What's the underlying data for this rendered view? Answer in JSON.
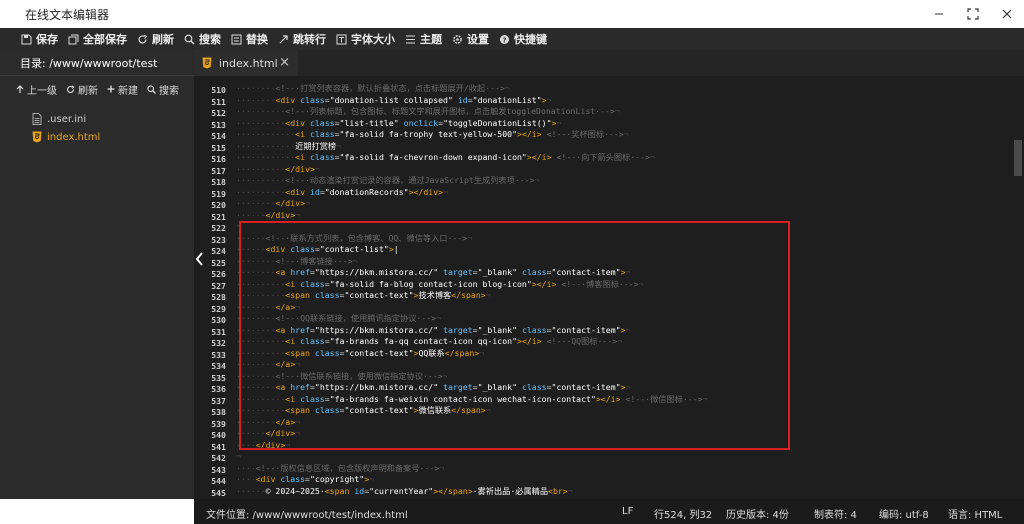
{
  "window": {
    "title": "在线文本编辑器"
  },
  "toolbar": {
    "items": [
      {
        "label": "保存",
        "icon": "save-icon"
      },
      {
        "label": "全部保存",
        "icon": "save-all-icon"
      },
      {
        "label": "刷新",
        "icon": "refresh-icon"
      },
      {
        "label": "搜索",
        "icon": "search-icon"
      },
      {
        "label": "替换",
        "icon": "replace-icon"
      },
      {
        "label": "跳转行",
        "icon": "goto-line-icon"
      },
      {
        "label": "字体大小",
        "icon": "font-size-icon"
      },
      {
        "label": "主题",
        "icon": "theme-icon"
      },
      {
        "label": "设置",
        "icon": "settings-icon"
      },
      {
        "label": "快捷键",
        "icon": "shortcut-icon"
      }
    ]
  },
  "sidebar": {
    "title": "目录: /www/wwwroot/test",
    "actions": [
      "上一级",
      "刷新",
      "新建",
      "搜索"
    ],
    "files": [
      {
        "name": ".user.ini",
        "active": false
      },
      {
        "name": "index.html",
        "active": true
      }
    ]
  },
  "tabs": [
    {
      "label": "index.html"
    }
  ],
  "editor": {
    "line_numbers": [
      "510",
      "511",
      "512",
      "513",
      "514",
      "515",
      "516",
      "517",
      "518",
      "519",
      "520",
      "521",
      "522",
      "523",
      "524",
      "525",
      "526",
      "527",
      "528",
      "529",
      "530",
      "531",
      "532",
      "533",
      "534",
      "535",
      "536",
      "537",
      "538",
      "539",
      "540",
      "541",
      "542",
      "543",
      "544",
      "545"
    ]
  },
  "statusbar": {
    "file_location": "文件位置: /www/wwwroot/test/index.html",
    "line_ending": "LF",
    "cursor": "行524, 列32",
    "history": "历史版本: 4份",
    "tab_size": "制表符: 4",
    "encoding": "编码: utf-8",
    "language": "语言: HTML"
  },
  "colors": {
    "highlight_border": "#d82020",
    "tag": "#e8a317",
    "attr": "#61c3ff",
    "comment": "#6a6a6a"
  }
}
